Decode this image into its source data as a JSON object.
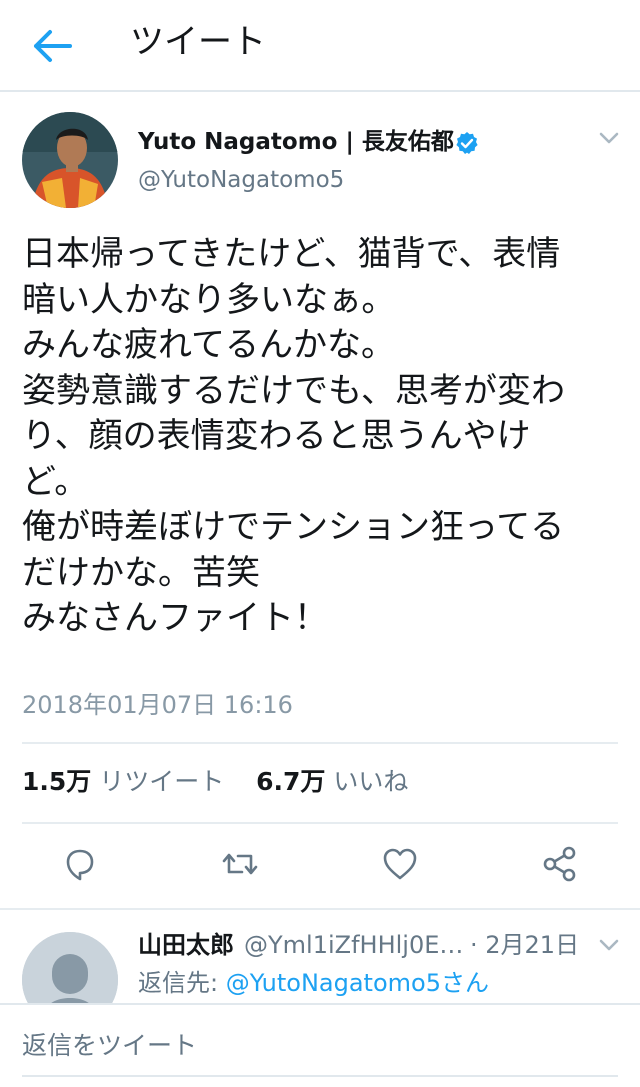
{
  "header": {
    "title": "ツイート"
  },
  "tweet": {
    "author_name": "Yuto Nagatomo | 長友佑都",
    "author_handle": "@YutoNagatomo5",
    "lines": [
      "日本帰ってきたけど、猫背で、表情",
      "暗い人かなり多いなぁ。",
      "みんな疲れてるんかな。",
      "姿勢意識するだけでも、思考が変わ",
      "り、顔の表情変わると思うんやけ",
      "ど。",
      "俺が時差ぼけでテンション狂ってる",
      "だけかな。苦笑",
      "みなさんファイト！"
    ],
    "timestamp": "2018年01月07日 16:16",
    "retweet_count": "1.5万",
    "retweet_label": "リツイート",
    "like_count": "6.7万",
    "like_label": "いいね"
  },
  "reply": {
    "name": "山田太郎",
    "handle": "@Yml1iZfHHlj0E…",
    "date": "· 2月21日",
    "reply_to_prefix": "返信先:",
    "reply_to_handle": "@YutoNagatomo5さん"
  },
  "composer": {
    "placeholder": "返信をツイート"
  },
  "colors": {
    "accent": "#1da1f2",
    "text": "#14171a",
    "muted": "#657786",
    "divider": "#e6ecf0"
  },
  "icons": [
    "back-arrow-icon",
    "verified-badge-icon",
    "chevron-down-icon",
    "reply-icon",
    "retweet-icon",
    "like-icon",
    "share-icon"
  ]
}
